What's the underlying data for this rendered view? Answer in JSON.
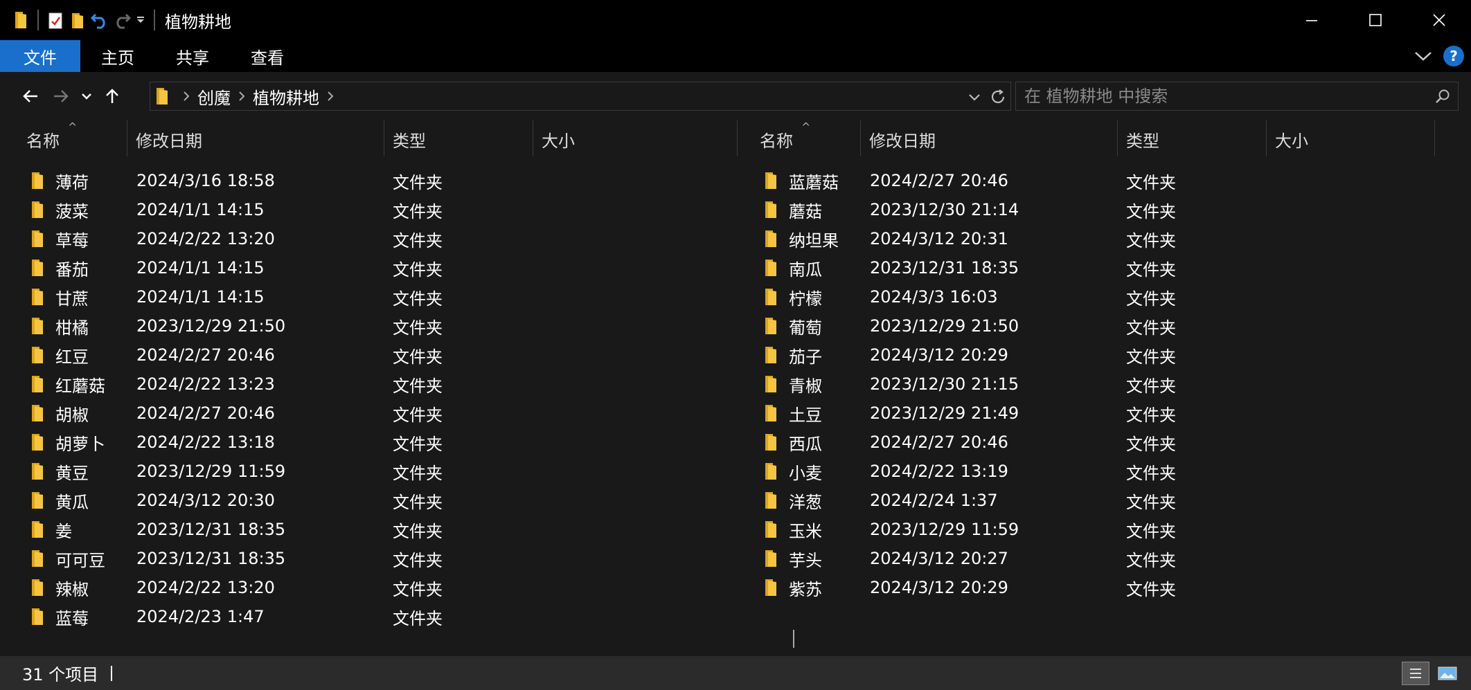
{
  "window": {
    "title": "植物耕地",
    "minimize_icon": "minimize-icon",
    "maximize_icon": "maximize-icon",
    "close_icon": "close-icon"
  },
  "ribbon": {
    "tabs": [
      {
        "label": "文件"
      },
      {
        "label": "主页"
      },
      {
        "label": "共享"
      },
      {
        "label": "查看"
      }
    ],
    "accent": "#1a6fcc",
    "help": "?"
  },
  "address": {
    "crumbs": [
      "创魔",
      "植物耕地"
    ]
  },
  "search": {
    "placeholder": "在 植物耕地 中搜索"
  },
  "columns": {
    "name": "名称",
    "date": "修改日期",
    "type": "类型",
    "size": "大小"
  },
  "files_left": [
    {
      "name": "薄荷",
      "date": "2024/3/16 18:58",
      "type": "文件夹"
    },
    {
      "name": "菠菜",
      "date": "2024/1/1 14:15",
      "type": "文件夹"
    },
    {
      "name": "草莓",
      "date": "2024/2/22 13:20",
      "type": "文件夹"
    },
    {
      "name": "番茄",
      "date": "2024/1/1 14:15",
      "type": "文件夹"
    },
    {
      "name": "甘蔗",
      "date": "2024/1/1 14:15",
      "type": "文件夹"
    },
    {
      "name": "柑橘",
      "date": "2023/12/29 21:50",
      "type": "文件夹"
    },
    {
      "name": "红豆",
      "date": "2024/2/27 20:46",
      "type": "文件夹"
    },
    {
      "name": "红蘑菇",
      "date": "2024/2/22 13:23",
      "type": "文件夹"
    },
    {
      "name": "胡椒",
      "date": "2024/2/27 20:46",
      "type": "文件夹"
    },
    {
      "name": "胡萝卜",
      "date": "2024/2/22 13:18",
      "type": "文件夹"
    },
    {
      "name": "黄豆",
      "date": "2023/12/29 11:59",
      "type": "文件夹"
    },
    {
      "name": "黄瓜",
      "date": "2024/3/12 20:30",
      "type": "文件夹"
    },
    {
      "name": "姜",
      "date": "2023/12/31 18:35",
      "type": "文件夹"
    },
    {
      "name": "可可豆",
      "date": "2023/12/31 18:35",
      "type": "文件夹"
    },
    {
      "name": "辣椒",
      "date": "2024/2/22 13:20",
      "type": "文件夹"
    },
    {
      "name": "蓝莓",
      "date": "2024/2/23 1:47",
      "type": "文件夹"
    }
  ],
  "files_right": [
    {
      "name": "蓝蘑菇",
      "date": "2024/2/27 20:46",
      "type": "文件夹"
    },
    {
      "name": "蘑菇",
      "date": "2023/12/30 21:14",
      "type": "文件夹"
    },
    {
      "name": "纳坦果",
      "date": "2024/3/12 20:31",
      "type": "文件夹"
    },
    {
      "name": "南瓜",
      "date": "2023/12/31 18:35",
      "type": "文件夹"
    },
    {
      "name": "柠檬",
      "date": "2024/3/3 16:03",
      "type": "文件夹"
    },
    {
      "name": "葡萄",
      "date": "2023/12/29 21:50",
      "type": "文件夹"
    },
    {
      "name": "茄子",
      "date": "2024/3/12 20:29",
      "type": "文件夹"
    },
    {
      "name": "青椒",
      "date": "2023/12/30 21:15",
      "type": "文件夹"
    },
    {
      "name": "土豆",
      "date": "2023/12/29 21:49",
      "type": "文件夹"
    },
    {
      "name": "西瓜",
      "date": "2024/2/27 20:46",
      "type": "文件夹"
    },
    {
      "name": "小麦",
      "date": "2024/2/22 13:19",
      "type": "文件夹"
    },
    {
      "name": "洋葱",
      "date": "2024/2/24 1:37",
      "type": "文件夹"
    },
    {
      "name": "玉米",
      "date": "2023/12/29 11:59",
      "type": "文件夹"
    },
    {
      "name": "芋头",
      "date": "2024/3/12 20:27",
      "type": "文件夹"
    },
    {
      "name": "紫苏",
      "date": "2024/3/12 20:29",
      "type": "文件夹"
    }
  ],
  "status": {
    "count": "31 个项目"
  },
  "colors": {
    "background": "#191919",
    "folder": "#f5c542",
    "folder_dark": "#d9a520"
  }
}
